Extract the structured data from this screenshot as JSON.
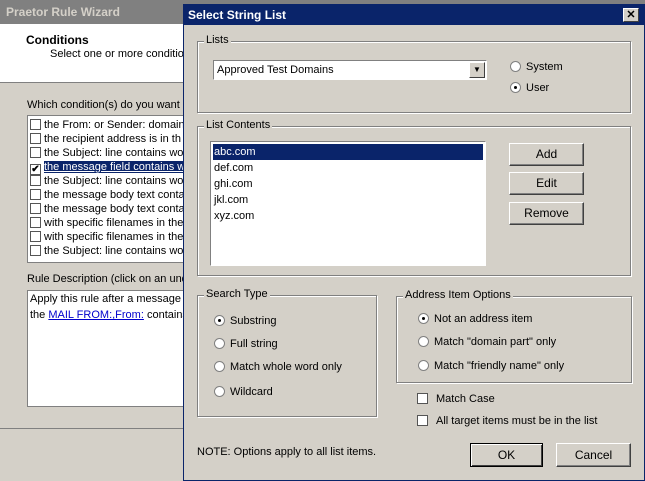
{
  "background": {
    "title": "Praetor Rule Wizard",
    "header_title": "Conditions",
    "header_subtitle": "Select one or more condition",
    "question": "Which condition(s) do you want t",
    "conditions": [
      {
        "label": "the From: or Sender: domain",
        "checked": false
      },
      {
        "label": "the recipient address is in th",
        "checked": false
      },
      {
        "label": "the Subject: line contains wo",
        "checked": false
      },
      {
        "label": "the message field contains w",
        "checked": true
      },
      {
        "label": "the Subject: line contains wo",
        "checked": false
      },
      {
        "label": "the message body text conta",
        "checked": false
      },
      {
        "label": "the message body text conta",
        "checked": false
      },
      {
        "label": "with specific filenames in the",
        "checked": false
      },
      {
        "label": "with specific filenames in the",
        "checked": false
      },
      {
        "label": "the Subject: line contains wo",
        "checked": false
      }
    ],
    "rule_description_label": "Rule Description (click on an und",
    "rule_desc_line1": "Apply this rule after a message",
    "rule_desc_line2_prefix": "the ",
    "rule_desc_link": "MAIL FROM:,From:",
    "rule_desc_line2_suffix": " contains"
  },
  "dialog": {
    "title": "Select String List",
    "close_glyph": "✕",
    "lists_label": "Lists",
    "selected_list": "Approved Test Domains",
    "scope_options": [
      {
        "label": "System",
        "selected": false
      },
      {
        "label": "User",
        "selected": true
      }
    ],
    "list_contents_label": "List Contents",
    "list_items": [
      "abc.com",
      "def.com",
      "ghi.com",
      "jkl.com",
      "xyz.com"
    ],
    "selected_item": "abc.com",
    "add_label": "Add",
    "edit_label": "Edit",
    "remove_label": "Remove",
    "search_type_label": "Search Type",
    "search_types": [
      {
        "label": "Substring",
        "selected": true
      },
      {
        "label": "Full string",
        "selected": false
      },
      {
        "label": "Match whole word only",
        "selected": false
      },
      {
        "label": "Wildcard",
        "selected": false
      }
    ],
    "address_options_label": "Address Item Options",
    "address_options": [
      {
        "label": "Not an address item",
        "selected": true
      },
      {
        "label": "Match \"domain part\" only",
        "selected": false
      },
      {
        "label": "Match \"friendly name\" only",
        "selected": false
      }
    ],
    "match_case_label": "Match Case",
    "all_target_label": "All target items must be in the list",
    "note": "NOTE: Options apply to all list items.",
    "ok_label": "OK",
    "cancel_label": "Cancel"
  }
}
